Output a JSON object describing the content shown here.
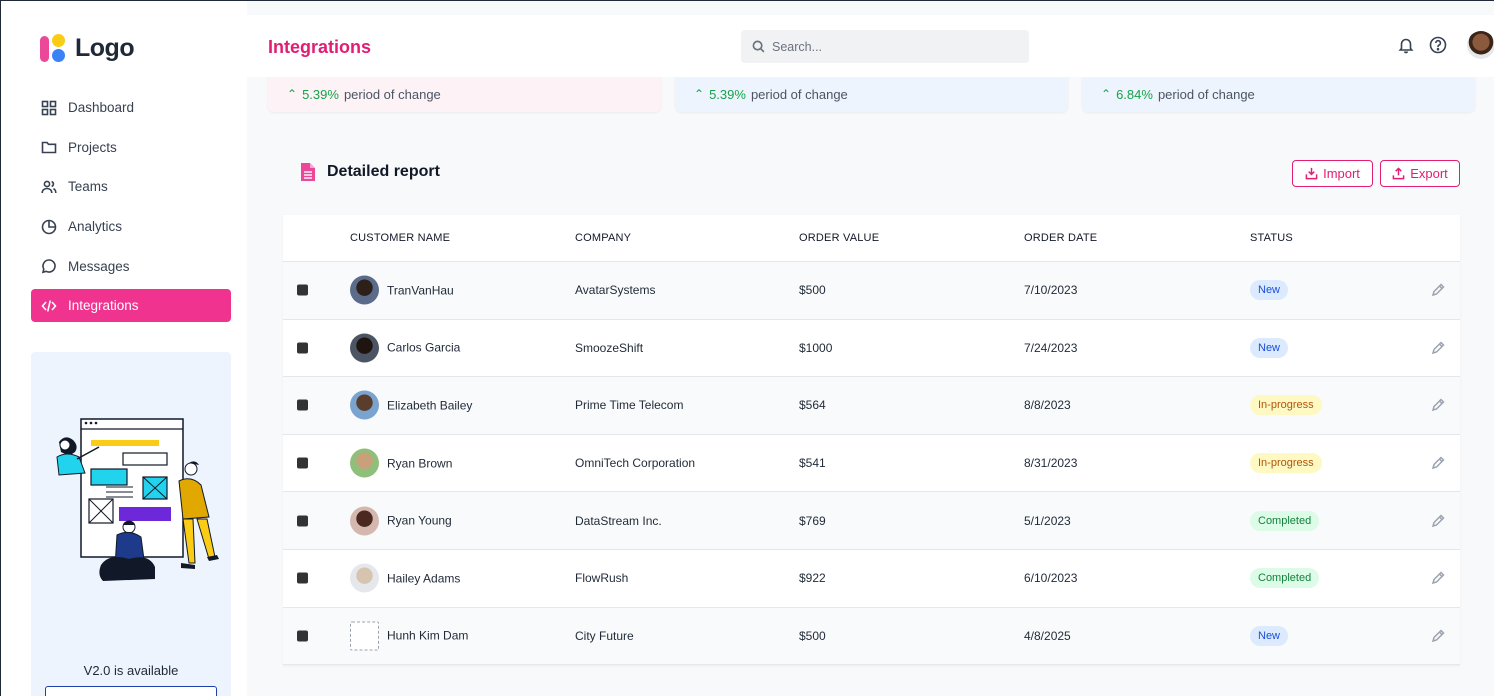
{
  "app": {
    "logo_text": "Logo",
    "page_title": "Integrations"
  },
  "search": {
    "placeholder": "Search..."
  },
  "sidebar": {
    "items": [
      {
        "label": "Dashboard",
        "icon": "grid-icon"
      },
      {
        "label": "Projects",
        "icon": "folder-icon"
      },
      {
        "label": "Teams",
        "icon": "users-icon"
      },
      {
        "label": "Analytics",
        "icon": "pie-chart-icon"
      },
      {
        "label": "Messages",
        "icon": "chat-icon"
      },
      {
        "label": "Integrations",
        "icon": "code-icon",
        "active": true
      }
    ],
    "promo_text": "V2.0 is available"
  },
  "stats": [
    {
      "pct": "5.39%",
      "text": "period of change",
      "bg": "#fdf2f6"
    },
    {
      "pct": "5.39%",
      "text": "period of change",
      "bg": "#eef4fd"
    },
    {
      "pct": "6.84%",
      "text": "period of change",
      "bg": "#eef4fd"
    }
  ],
  "report": {
    "title": "Detailed report",
    "import_label": "Import",
    "export_label": "Export",
    "columns": [
      "CUSTOMER NAME",
      "COMPANY",
      "ORDER VALUE",
      "ORDER DATE",
      "STATUS"
    ],
    "rows": [
      {
        "name": "TranVanHau",
        "company": "AvatarSystems",
        "value": "$500",
        "date": "7/10/2023",
        "status": "New"
      },
      {
        "name": "Carlos Garcia",
        "company": "SmoozeShift",
        "value": "$1000",
        "date": "7/24/2023",
        "status": "New"
      },
      {
        "name": "Elizabeth Bailey",
        "company": "Prime Time Telecom",
        "value": "$564",
        "date": "8/8/2023",
        "status": "In-progress"
      },
      {
        "name": "Ryan Brown",
        "company": "OmniTech Corporation",
        "value": "$541",
        "date": "8/31/2023",
        "status": "In-progress"
      },
      {
        "name": "Ryan Young",
        "company": "DataStream Inc.",
        "value": "$769",
        "date": "5/1/2023",
        "status": "Completed"
      },
      {
        "name": "Hailey Adams",
        "company": "FlowRush",
        "value": "$922",
        "date": "6/10/2023",
        "status": "Completed"
      },
      {
        "name": "Hunh Kim Dam",
        "company": "City Future",
        "value": "$500",
        "date": "4/8/2025",
        "status": "New"
      }
    ]
  },
  "colors": {
    "accent": "#f0338f",
    "title": "#e11d74",
    "status_new": "#dbeafe",
    "status_progress": "#fef9c3",
    "status_completed": "#dcfce7"
  }
}
